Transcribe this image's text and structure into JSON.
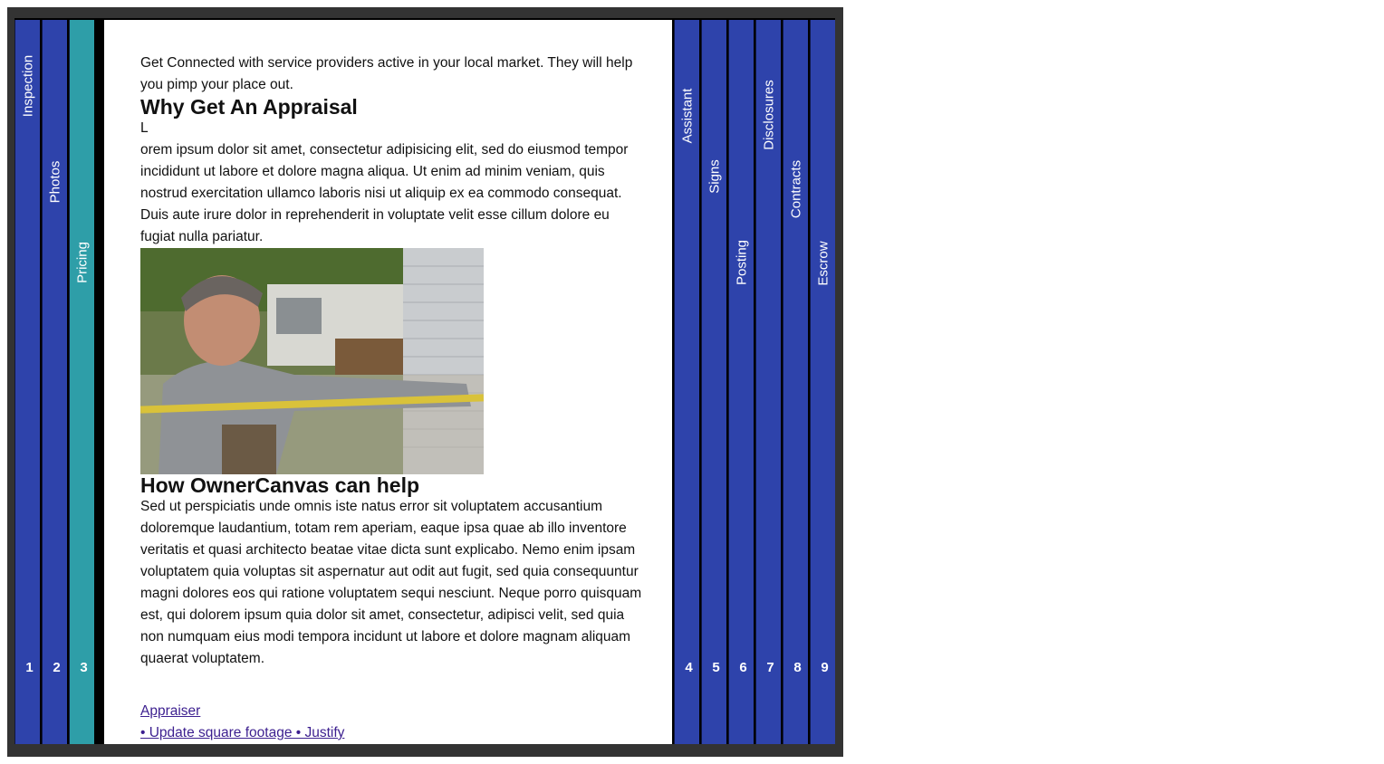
{
  "tabs_left": [
    {
      "label": "Inspection",
      "number": "1"
    },
    {
      "label": "Photos",
      "number": "2"
    },
    {
      "label": "Pricing",
      "number": "3"
    }
  ],
  "tabs_right": [
    {
      "label": "Assistant",
      "number": "4"
    },
    {
      "label": "Signs",
      "number": "5"
    },
    {
      "label": "Posting",
      "number": "6"
    },
    {
      "label": "Disclosures",
      "number": "7"
    },
    {
      "label": "Contracts",
      "number": "8"
    },
    {
      "label": "Escrow",
      "number": "9"
    }
  ],
  "active_tab": "Pricing",
  "colors": {
    "tab": "#2e43ab",
    "active_tab": "#2e9ea8",
    "link": "#3c1f8f"
  },
  "content": {
    "intro": "Get Connected with service providers active in your local market. They will help you pimp your place out.",
    "heading1": "Why Get An Appraisal",
    "dropcap": "L",
    "para1": "orem ipsum dolor sit amet, consectetur adipisicing elit, sed do eiusmod tempor incididunt ut labore et dolore magna aliqua. Ut enim ad minim veniam, quis nostrud exercitation ullamco laboris nisi ut aliquip ex ea commodo consequat. Duis aute irure dolor in reprehenderit in voluptate velit esse cillum dolore eu fugiat nulla pariatur.",
    "photo_icon": "appraiser-measuring-photo",
    "heading2": "How OwnerCanvas can help",
    "para2": "Sed ut perspiciatis unde omnis iste natus error sit voluptatem accusantium doloremque laudantium, totam rem aperiam, eaque ipsa quae ab illo inventore veritatis et quasi architecto beatae vitae dicta sunt explicabo. Nemo enim ipsam voluptatem quia voluptas sit aspernatur aut odit aut fugit, sed quia consequuntur magni dolores eos qui ratione voluptatem sequi nesciunt. Neque porro quisquam est, qui dolorem ipsum quia dolor sit amet, consectetur, adipisci velit, sed quia non numquam eius modi tempora incidunt ut labore et dolore magnam aliquam quaerat voluptatem.",
    "link1": "Appraiser",
    "link2": "• Update square footage • Justify"
  }
}
